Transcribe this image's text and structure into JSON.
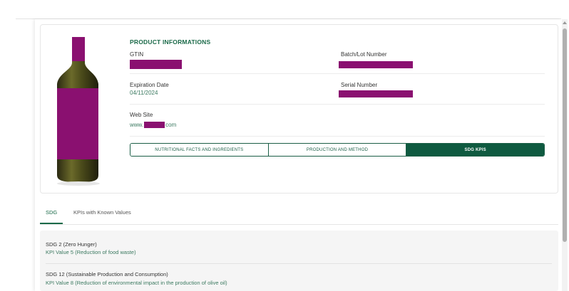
{
  "product": {
    "heading": "PRODUCT INFORMATIONS",
    "gtin_label": "GTIN",
    "batch_label": "Batch/Lot Number",
    "expiration_label": "Expiration Date",
    "expiration_value": "04/11/2024",
    "serial_label": "Serial Number",
    "website_label": "Web Site",
    "website_prefix": "www.",
    "website_suffix": "com"
  },
  "tabs": [
    {
      "label": "NUTRITIONAL FACTS AND INGREDIENTS",
      "active": false
    },
    {
      "label": "PRODUCTION AND METHOD",
      "active": false
    },
    {
      "label": "SDG KPIS",
      "active": true
    }
  ],
  "subtabs": [
    {
      "label": "SDG",
      "active": true
    },
    {
      "label": "KPIs with Known Values",
      "active": false
    }
  ],
  "sdg_items": [
    {
      "title": "SDG 2 (Zero Hunger)",
      "value": "KPI Value 5 (Reduction of food waste)"
    },
    {
      "title": "SDG 12 (Sustainable Production and Consumption)",
      "value": "KPI Value 8 (Reduction of environmental impact in the production of olive oil)"
    }
  ],
  "colors": {
    "brand_green": "#0f5a40",
    "redaction": "#8a1070"
  }
}
